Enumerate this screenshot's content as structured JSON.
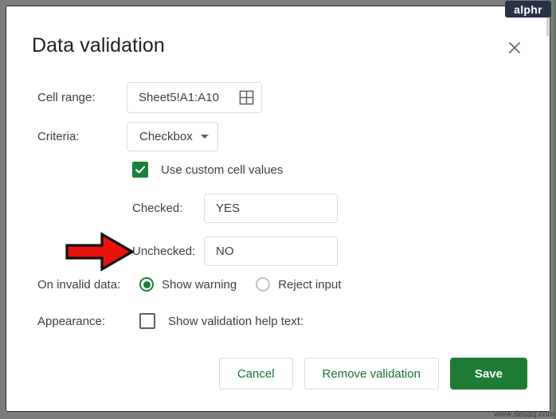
{
  "branding": {
    "badge_text": "alphr",
    "badge_color": "#27324a",
    "watermark": "www.deuaq.com"
  },
  "dialog": {
    "title": "Data validation",
    "close_icon": "close-icon"
  },
  "fields": {
    "cell_range": {
      "label": "Cell range:",
      "value": "Sheet5!A1:A10",
      "picker_icon": "grid-select-icon"
    },
    "criteria": {
      "label": "Criteria:",
      "value": "Checkbox",
      "caret_icon": "chevron-down-icon"
    },
    "use_custom_values": {
      "label": "Use custom cell values",
      "checked": true
    },
    "checked_value": {
      "label": "Checked:",
      "value": "YES",
      "placeholder": ""
    },
    "unchecked_value": {
      "label": "Unchecked:",
      "value": "NO",
      "placeholder": ""
    },
    "on_invalid_data": {
      "label": "On invalid data:",
      "options": [
        {
          "label": "Show warning",
          "selected": true
        },
        {
          "label": "Reject input",
          "selected": false
        }
      ]
    },
    "appearance": {
      "label": "Appearance:",
      "help_text_label": "Show validation help text:",
      "checked": false
    }
  },
  "footer": {
    "cancel_label": "Cancel",
    "remove_label": "Remove validation",
    "save_label": "Save"
  },
  "colors": {
    "accent_green": "#188038",
    "save_green": "#1e7b34",
    "link_green": "#137333",
    "text": "#3c4043",
    "border": "#dadce0",
    "frame_gray": "#7c7c7c",
    "arrow_red": "#e8120c"
  }
}
